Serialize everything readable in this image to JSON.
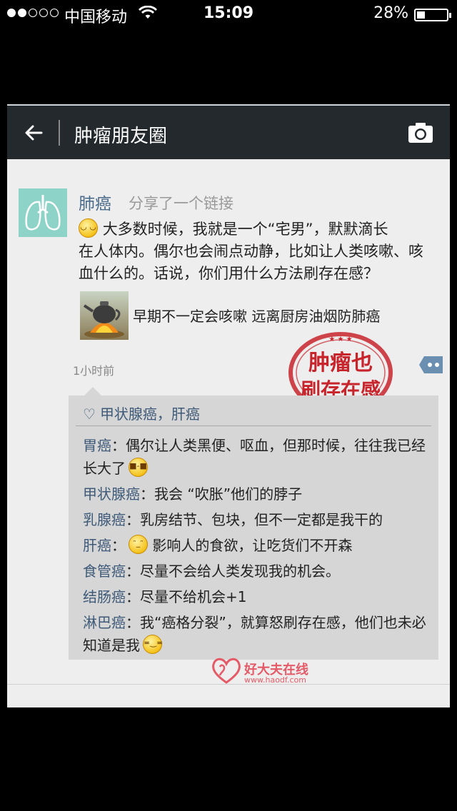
{
  "status_bar": {
    "carrier": "中国移动",
    "time": "15:09",
    "battery_pct": "28%",
    "battery_level": 0.28
  },
  "header": {
    "title": "肿瘤朋友圈",
    "back_icon": "arrow-left-icon",
    "camera_icon": "camera-icon"
  },
  "post": {
    "author": "肺癌",
    "action": "分享了一个链接",
    "text_line1": "大多数时候，我就是一个“宅男”，默默滴长",
    "text_rest": "在人体内。偶尔也会闹点动静，比如让人类咳嗽、咳血什么的。话说，你们用什么方法刷存在感？",
    "link_title": "早期不一定会咳嗽 远离厨房油烟防肺癌",
    "time": "1小时前",
    "stamp_line1": "肿瘤也",
    "stamp_line2": "刷存在感"
  },
  "likes": "甲状腺癌，肝癌",
  "comments": [
    {
      "name": "胃癌",
      "text_before": "偶尔让人类黑便、呕血，但那时候，往往我已经长大了",
      "emoji": "sunglasses",
      "text_after": ""
    },
    {
      "name": "甲状腺癌",
      "text_before": "我会 “吹胀”他们的脖子",
      "emoji": "",
      "text_after": ""
    },
    {
      "name": "乳腺癌",
      "text_before": "乳房结节、包块，但不一定都是我干的",
      "emoji": "",
      "text_after": ""
    },
    {
      "name": "肝癌",
      "text_before": "",
      "emoji": "thinking",
      "text_after": " 影响人的食欲，让吃货们不开森"
    },
    {
      "name": "食管癌",
      "text_before": "尽量不会给人类发现我的机会。",
      "emoji": "",
      "text_after": ""
    },
    {
      "name": "结肠癌",
      "text_before": "尽量不给机会+1",
      "emoji": "",
      "text_after": ""
    },
    {
      "name": "淋巴癌",
      "text_before": "我“癌格分裂”，就算怒刷存在感，他们也未必知道是我",
      "emoji": "grin",
      "text_after": ""
    }
  ],
  "watermark": {
    "text": "好大夫在线",
    "url": "www.haodf.com"
  },
  "colors": {
    "header_bg": "#24292d",
    "name_blue": "#3e5a78",
    "stamp_red": "#c8242c",
    "watermark_pink": "#e55a67"
  }
}
